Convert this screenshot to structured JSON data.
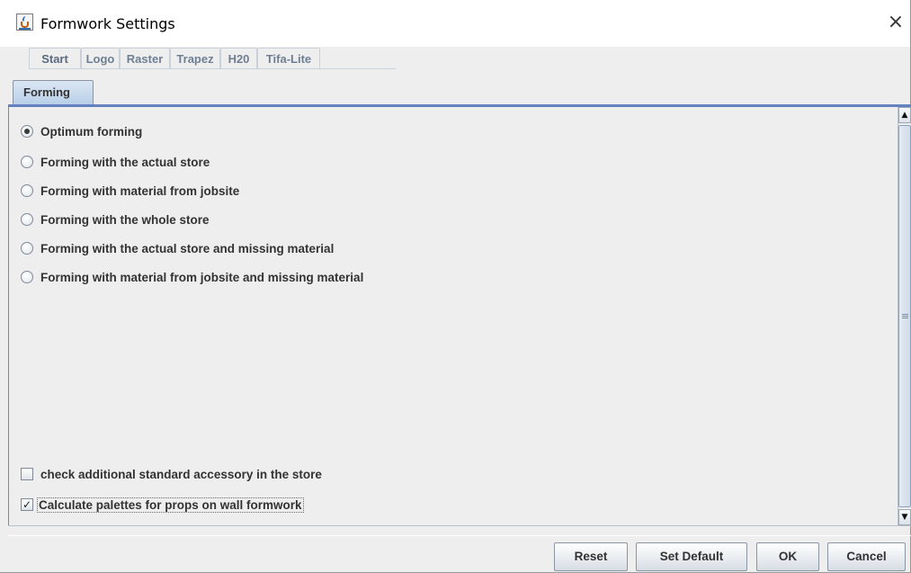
{
  "window": {
    "title": "Formwork Settings",
    "close_glyph": "×",
    "app_icon": "java-cup-icon"
  },
  "tabs": [
    {
      "label": "Start",
      "selected": true
    },
    {
      "label": "Logo",
      "selected": false
    },
    {
      "label": "Raster",
      "selected": false
    },
    {
      "label": "Trapez",
      "selected": false
    },
    {
      "label": "H20",
      "selected": false
    },
    {
      "label": "Tifa-Lite",
      "selected": false
    }
  ],
  "subtabs": [
    {
      "label": "Forming",
      "selected": true
    }
  ],
  "forming": {
    "options": [
      {
        "label": "Optimum forming",
        "checked": true
      },
      {
        "label": "Forming with the actual store",
        "checked": false
      },
      {
        "label": "Forming with material from jobsite",
        "checked": false
      },
      {
        "label": "Forming with the whole store",
        "checked": false
      },
      {
        "label": "Forming with the actual store and missing material",
        "checked": false
      },
      {
        "label": "Forming with material from jobsite and missing material",
        "checked": false
      }
    ],
    "checkboxes": [
      {
        "label": "check additional standard accessory in the store",
        "checked": false
      },
      {
        "label": "Calculate palettes for props on wall formwork",
        "checked": true
      }
    ]
  },
  "buttons": {
    "reset": "Reset",
    "set_default": "Set Default",
    "ok": "OK",
    "cancel": "Cancel"
  },
  "colors": {
    "accent": "#6382bf",
    "tab_text": "#6f7f93",
    "panel_bg": "#eeeeee"
  }
}
